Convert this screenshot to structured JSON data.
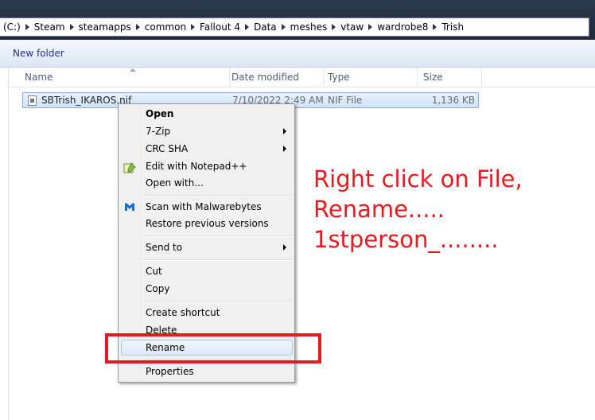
{
  "breadcrumb": {
    "items": [
      "(C:)",
      "Steam",
      "steamapps",
      "common",
      "Fallout 4",
      "Data",
      "meshes",
      "vtaw",
      "wardrobe8",
      "Trish"
    ]
  },
  "toolbar": {
    "new_folder": "New folder"
  },
  "columns": {
    "name": "Name",
    "date": "Date modified",
    "type": "Type",
    "size": "Size"
  },
  "file": {
    "name": "SBTrish_IKAROS.nif",
    "date": "7/10/2022 2:49 AM",
    "type": "NIF File",
    "size": "1,136 KB",
    "icon": "nif-file-icon"
  },
  "context_menu": {
    "open": "Open",
    "zip": "7-Zip",
    "crc": "CRC SHA",
    "notepad": "Edit with Notepad++",
    "open_with": "Open with...",
    "malwarebytes": "Scan with Malwarebytes",
    "restore": "Restore previous versions",
    "send_to": "Send to",
    "cut": "Cut",
    "copy": "Copy",
    "shortcut": "Create shortcut",
    "delete": "Delete",
    "rename": "Rename",
    "properties": "Properties"
  },
  "annotation": {
    "line1": "Right click on File,",
    "line2": "Rename.....",
    "line3": "1stperson_........",
    "color": "#e8191f"
  }
}
